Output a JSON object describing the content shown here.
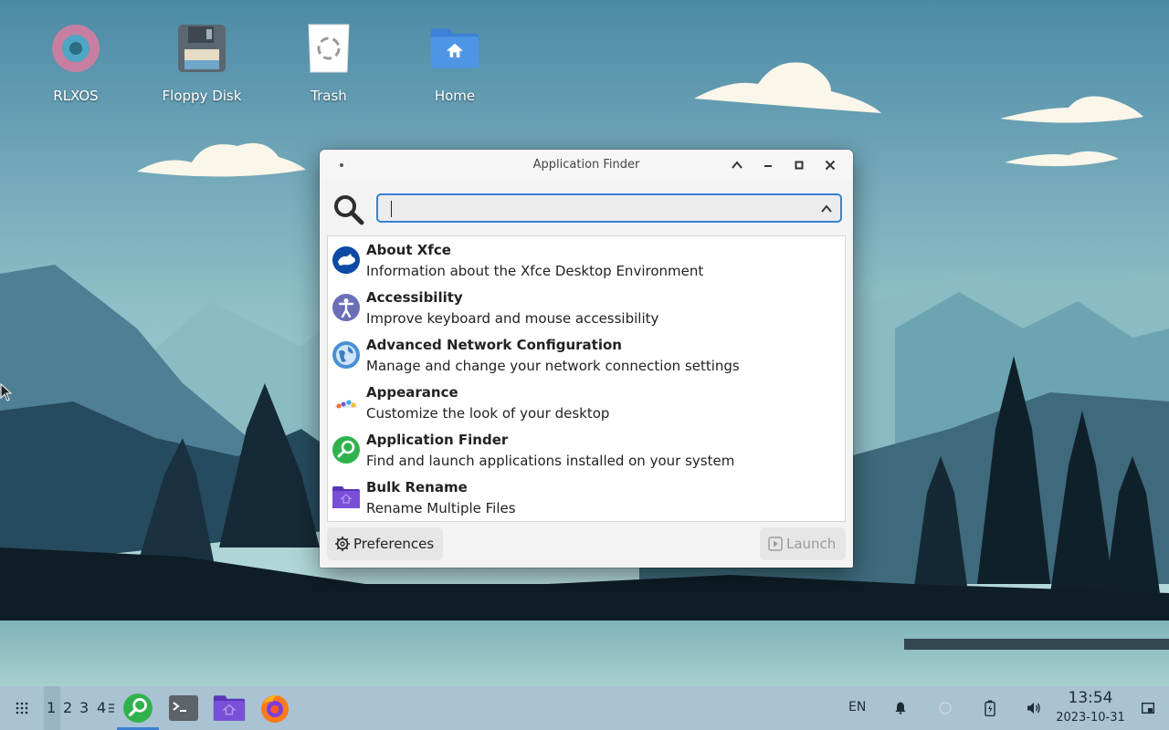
{
  "desktop": {
    "icons": [
      {
        "label": "RLXOS",
        "icon": "rlxos-disc-icon"
      },
      {
        "label": "Floppy Disk",
        "icon": "floppy-disk-icon"
      },
      {
        "label": "Trash",
        "icon": "trash-icon"
      },
      {
        "label": "Home",
        "icon": "home-folder-icon"
      }
    ]
  },
  "window": {
    "title": "Application Finder",
    "search": {
      "value": "",
      "placeholder": ""
    },
    "apps": [
      {
        "name": "About Xfce",
        "description": "Information about the Xfce Desktop Environment",
        "icon": "xfce-mouse-icon"
      },
      {
        "name": "Accessibility",
        "description": "Improve keyboard and mouse accessibility",
        "icon": "accessibility-icon"
      },
      {
        "name": "Advanced Network Configuration",
        "description": "Manage and change your network connection settings",
        "icon": "network-globe-icon"
      },
      {
        "name": "Appearance",
        "description": "Customize the look of your desktop",
        "icon": "appearance-icon"
      },
      {
        "name": "Application Finder",
        "description": "Find and launch applications installed on your system",
        "icon": "app-finder-icon"
      },
      {
        "name": "Bulk Rename",
        "description": "Rename Multiple Files",
        "icon": "bulk-rename-folder-icon"
      }
    ],
    "preferences_label": "Preferences",
    "launch_label": "Launch"
  },
  "taskbar": {
    "workspaces": [
      "1",
      "2",
      "3",
      "4"
    ],
    "active_workspace": "1",
    "language": "EN",
    "time": "13:54",
    "date": "2023-10-31"
  },
  "colors": {
    "accent": "#3b7fd2",
    "taskbar": "#a9c3d3",
    "finder_green": "#2fb24c",
    "folder_purple": "#7a4fd8"
  }
}
